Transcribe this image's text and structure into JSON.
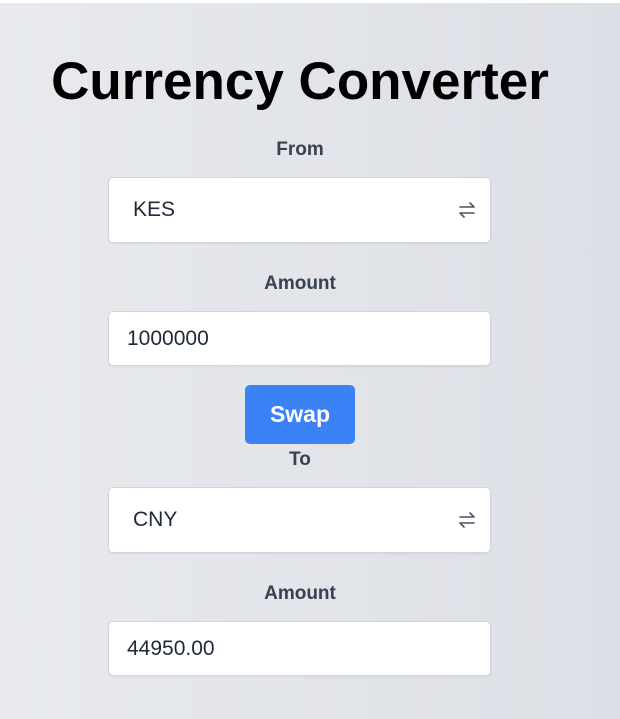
{
  "title": "Currency Converter",
  "from": {
    "label": "From",
    "currency": "KES",
    "amount_label": "Amount",
    "amount": "1000000",
    "select_icon": "swap-arrows-icon"
  },
  "swap_label": "Swap",
  "to": {
    "label": "To",
    "currency": "CNY",
    "amount_label": "Amount",
    "amount": "44950.00",
    "select_icon": "swap-arrows-icon"
  },
  "colors": {
    "accent": "#3b82f6",
    "label_text": "#374151",
    "title_text": "#000000"
  }
}
